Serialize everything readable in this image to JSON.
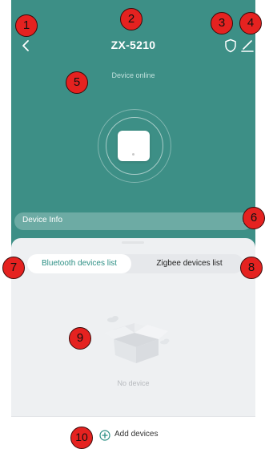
{
  "header": {
    "title": "ZX-5210",
    "back_icon": "chevron-left-icon",
    "shield_icon": "shield-icon",
    "edit_icon": "edit-pencil-icon"
  },
  "device": {
    "status": "Device online",
    "image_icon": "gateway-device-icon"
  },
  "device_info": {
    "label": "Device Info",
    "chevron": "›"
  },
  "tabs": [
    {
      "label": "Bluetooth devices list",
      "active": true
    },
    {
      "label": "Zigbee devices list",
      "active": false
    }
  ],
  "empty_state": {
    "text": "No device",
    "icon": "empty-box-icon"
  },
  "footer": {
    "add_label": "Add devices",
    "add_icon": "plus-circle-icon"
  },
  "annotations": [
    "1",
    "2",
    "3",
    "4",
    "5",
    "6",
    "7",
    "8",
    "9",
    "10"
  ],
  "colors": {
    "hero": "#3d8f86",
    "accent": "#2c8f84",
    "badge": "#e52220"
  }
}
